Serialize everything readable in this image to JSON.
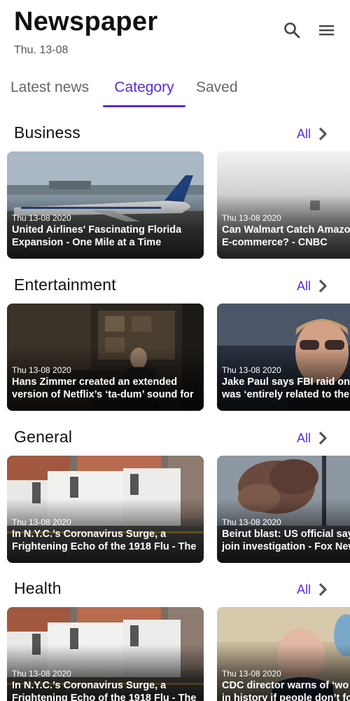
{
  "header": {
    "title": "Newspaper",
    "date": "Thu. 13-08",
    "icons": [
      "search-icon",
      "menu-icon"
    ]
  },
  "tabs": [
    {
      "label": "Latest news",
      "active": false
    },
    {
      "label": "Category",
      "active": true
    },
    {
      "label": "Saved",
      "active": false
    }
  ],
  "colors": {
    "accent": "#5b2bd6",
    "text": "#111111",
    "muted": "#666666"
  },
  "sections": [
    {
      "title": "Business",
      "all_label": "All",
      "articles": [
        {
          "date": "Thu 13-08 2020",
          "line1": "United Airlines' Fascinating Florida",
          "line2": "Expansion - One Mile at a Time"
        },
        {
          "date": "Thu 13-08 2020",
          "line1": "Can Walmart Catch Amazo",
          "line2": "E-commerce? - CNBC"
        }
      ]
    },
    {
      "title": "Entertainment",
      "all_label": "All",
      "articles": [
        {
          "date": "Thu 13-08 2020",
          "line1": "Hans Zimmer created an extended",
          "line2": "version of Netflix’s ‘ta-dum’ sound for"
        },
        {
          "date": "Thu 13-08 2020",
          "line1": "Jake Paul says FBI raid on h",
          "line2": "was ‘entirely related to the"
        }
      ]
    },
    {
      "title": "General",
      "all_label": "All",
      "articles": [
        {
          "date": "Thu 13-08 2020",
          "line1": "In N.Y.C.’s Coronavirus Surge, a",
          "line2": "Frightening Echo of the 1918 Flu - The"
        },
        {
          "date": "Thu 13-08 2020",
          "line1": "Beirut blast: US official say",
          "line2": "join investigation - Fox New"
        }
      ]
    },
    {
      "title": "Health",
      "all_label": "All",
      "articles": [
        {
          "date": "Thu 13-08 2020",
          "line1": "In N.Y.C.’s Coronavirus Surge, a",
          "line2": "Frightening Echo of the 1918 Flu - The"
        },
        {
          "date": "Thu 13-08 2020",
          "line1": "CDC director warns of ‘wo",
          "line2": "in history if people don’t fo"
        }
      ]
    }
  ]
}
